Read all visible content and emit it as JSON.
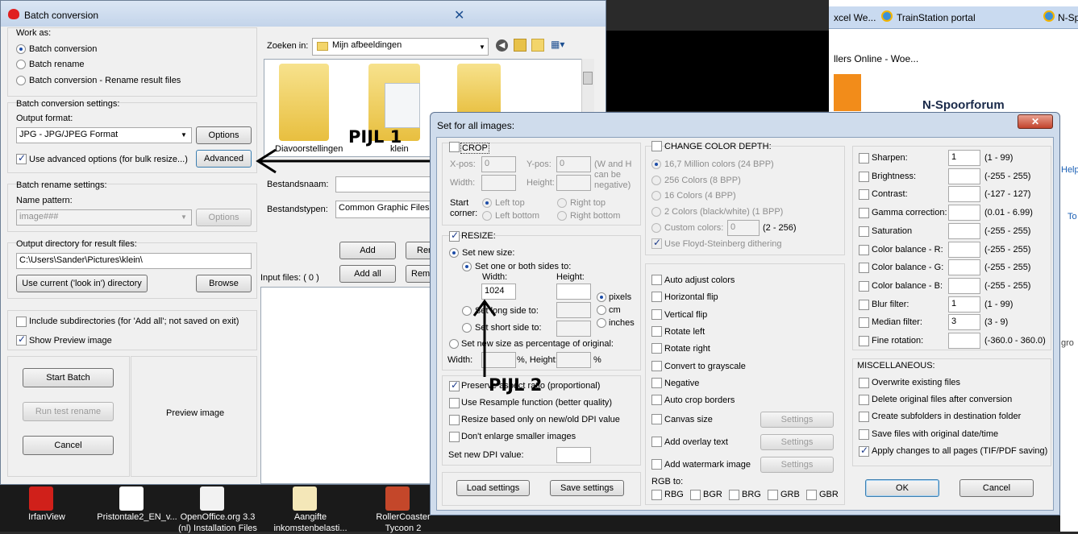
{
  "batch": {
    "title": "Batch conversion",
    "work_as": "Work as:",
    "modes": [
      "Batch conversion",
      "Batch rename",
      "Batch conversion - Rename result files"
    ],
    "conv_settings": "Batch conversion settings:",
    "output_format": "Output format:",
    "format_value": "JPG - JPG/JPEG Format",
    "options": "Options",
    "use_adv": "Use advanced options (for bulk resize...)",
    "advanced": "Advanced",
    "rename_settings": "Batch rename settings:",
    "name_pattern": "Name pattern:",
    "pattern_value": "image###",
    "outdir_label": "Output directory for result files:",
    "outdir_value": "C:\\Users\\Sander\\Pictures\\klein\\",
    "use_current": "Use current ('look in') directory",
    "browse": "Browse",
    "include_sub": "Include subdirectories (for 'Add all'; not saved on exit)",
    "show_preview": "Show Preview image",
    "start": "Start Batch",
    "run_test": "Run test rename",
    "cancel": "Cancel",
    "preview": "Preview image",
    "zoeken": "Zoeken in:",
    "zoeken_value": "Mijn afbeeldingen",
    "folder1": "Diavoorstellingen",
    "folder2": "klein",
    "bestandsnaam": "Bestandsnaam:",
    "bestandstypen": "Bestandstypen:",
    "types_value": "Common Graphic Files",
    "add": "Add",
    "add_all": "Add all",
    "ren": "Ren",
    "remo": "Remo",
    "input_files": "Input files: ( 0 )"
  },
  "background": {
    "tab1": "xcel We...",
    "tab2": "TrainStation portal",
    "tab3": "N-Sp",
    "page_line": "llers Online - Woe...",
    "forum": "N-Spoorforum",
    "help": "Help",
    "to": "To",
    "gro": "gro"
  },
  "annotations": {
    "pijl1": "PIJL 1",
    "pijl2": "PIJL 2"
  },
  "dialog": {
    "title": "Set for all images:",
    "crop": "CROP",
    "xpos": "X-pos:",
    "xpos_v": "0",
    "ypos": "Y-pos:",
    "ypos_v": "0",
    "wh_note": "(W and H can be negative)",
    "width": "Width:",
    "height": "Height:",
    "start_corner": "Start corner:",
    "left_top": "Left top",
    "right_top": "Right top",
    "left_bottom": "Left bottom",
    "right_bottom": "Right bottom",
    "resize": "RESIZE:",
    "set_new_size": "Set new size:",
    "set_sides": "Set one or both sides to:",
    "w_label": "Width:",
    "h_label": "Height:",
    "width_value": "1024",
    "pixels": "pixels",
    "cm": "cm",
    "inches": "inches",
    "long_side": "Set long side to:",
    "short_side": "Set short side to:",
    "pct": "Set new size as percentage of original:",
    "pct_w": "Width:",
    "pct_pct": "%, Height:",
    "pct_end": "%",
    "preserve": "Preserve aspect ratio (proportional)",
    "resample": "Use Resample function (better quality)",
    "dpi_only": "Resize based only on new/old DPI value",
    "no_enlarge": "Don't enlarge smaller images",
    "dpi": "Set new DPI value:",
    "load": "Load settings",
    "save": "Save settings",
    "color_depth": "CHANGE COLOR DEPTH:",
    "depths": [
      "16,7 Million colors (24 BPP)",
      "256 Colors (8 BPP)",
      "16 Colors (4 BPP)",
      "2 Colors (black/white) (1 BPP)"
    ],
    "custom": "Custom colors:",
    "custom_v": "0",
    "custom_range": "(2 - 256)",
    "floyd": "Use Floyd-Steinberg dithering",
    "effects": [
      "Auto adjust colors",
      "Horizontal flip",
      "Vertical flip",
      "Rotate left",
      "Rotate right",
      "Convert to grayscale",
      "Negative",
      "Auto crop borders"
    ],
    "canvas": "Canvas size",
    "overlay": "Add overlay text",
    "watermark": "Add watermark image",
    "settings": "Settings",
    "rgb_to": "RGB to:",
    "rgb": [
      "RBG",
      "BGR",
      "BRG",
      "GRB",
      "GBR"
    ],
    "filters": [
      {
        "l": "Sharpen:",
        "v": "1",
        "r": "(1  -  99)"
      },
      {
        "l": "Brightness:",
        "v": "",
        "r": "(-255  -  255)"
      },
      {
        "l": "Contrast:",
        "v": "",
        "r": "(-127  -  127)"
      },
      {
        "l": "Gamma correction:",
        "v": "",
        "r": "(0.01  -  6.99)"
      },
      {
        "l": "Saturation",
        "v": "",
        "r": "(-255  -  255)"
      },
      {
        "l": "Color balance - R:",
        "v": "",
        "r": "(-255  -  255)"
      },
      {
        "l": "Color balance - G:",
        "v": "",
        "r": "(-255  -  255)"
      },
      {
        "l": "Color balance - B:",
        "v": "",
        "r": "(-255  -  255)"
      },
      {
        "l": "Blur filter:",
        "v": "1",
        "r": "(1  -  99)"
      },
      {
        "l": "Median filter:",
        "v": "3",
        "r": "(3  -  9)"
      },
      {
        "l": "Fine rotation:",
        "v": "",
        "r": "(-360.0  -  360.0)"
      }
    ],
    "misc": "MISCELLANEOUS:",
    "misc_items": [
      "Overwrite existing files",
      "Delete original files after conversion",
      "Create subfolders in destination folder",
      "Save files with original date/time",
      "Apply changes to all pages (TIF/PDF saving)"
    ],
    "ok": "OK",
    "cancel": "Cancel"
  },
  "taskbar": [
    {
      "l1": "IrfanView",
      "l2": ""
    },
    {
      "l1": "Pristontale2_EN_v...",
      "l2": ""
    },
    {
      "l1": "OpenOffice.org 3.3",
      "l2": "(nl) Installation Files"
    },
    {
      "l1": "Aangifte",
      "l2": "inkomstenbelasti..."
    },
    {
      "l1": "RollerCoaster",
      "l2": "Tycoon 2"
    }
  ]
}
